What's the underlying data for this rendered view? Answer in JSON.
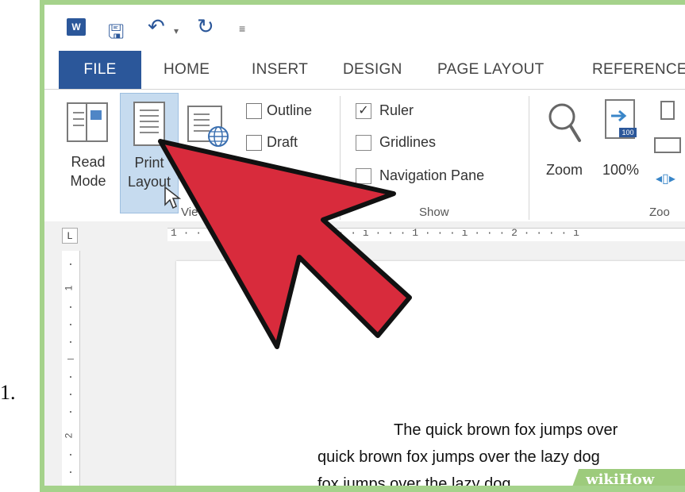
{
  "list_number": "1.",
  "qat": {
    "word_icon": "W",
    "icons": [
      "word-logo-icon",
      "save-icon",
      "undo-icon",
      "redo-icon",
      "customize-qat-icon"
    ]
  },
  "tabs": [
    "FILE",
    "HOME",
    "INSERT",
    "DESIGN",
    "PAGE LAYOUT",
    "REFERENCE"
  ],
  "ribbon": {
    "views": {
      "read_mode": [
        "Read",
        "Mode"
      ],
      "print_layout": [
        "Print",
        "Layout"
      ],
      "outline": "Outline",
      "draft": "Draft",
      "group_label": "Vie"
    },
    "show": {
      "ruler": "Ruler",
      "ruler_checked": "✓",
      "gridlines": "Gridlines",
      "navigation_pane": "Navigation Pane",
      "group_label": "Show"
    },
    "zoom": {
      "zoom": "Zoom",
      "hundred": "100%",
      "badge": "100",
      "group_label": "Zoo"
    }
  },
  "ruler": {
    "corner": "L",
    "horizontal": "1 · ·                    · · · ı · · · 1 · · · ı · · · 2 · · · · ı",
    "vertical": [
      "1",
      "2"
    ]
  },
  "document": {
    "line1": "The quick brown fox jumps over",
    "line2": "quick brown fox jumps over the lazy dog",
    "line3": "fox jumps over the lazy dog."
  },
  "watermark": "wikiHow",
  "colors": {
    "accent": "#2b579a",
    "frame": "#a5d28b",
    "arrow": "#d82b3c",
    "selected": "#c6dbef"
  }
}
